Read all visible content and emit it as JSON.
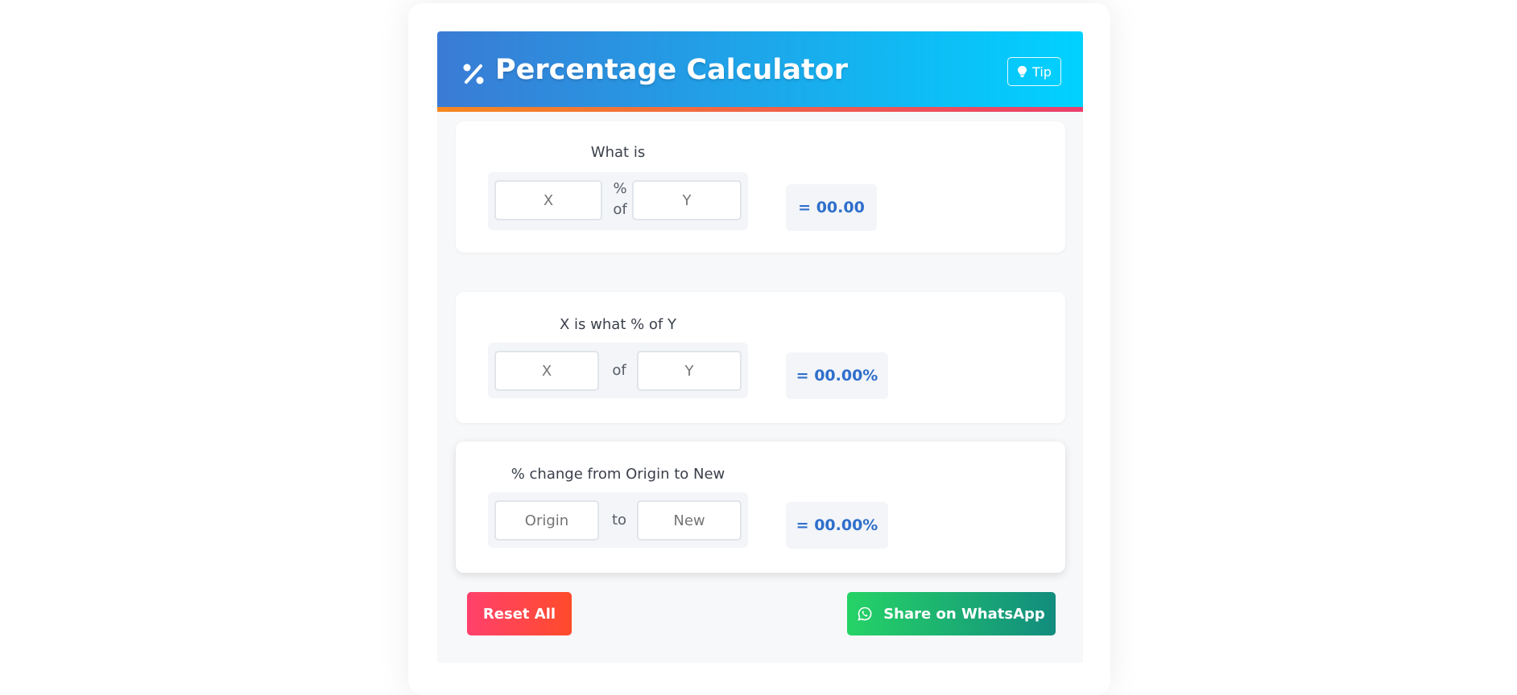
{
  "header": {
    "title": "Percentage Calculator",
    "icon": "percent-icon",
    "tip_label": "Tip",
    "tip_icon": "lightbulb-icon",
    "colors": {
      "gradient_start": "#3a7bd5",
      "gradient_end": "#00d2ff",
      "stripe_start": "#f6881f",
      "stripe_end": "#ea3e6d"
    }
  },
  "calculators": [
    {
      "label": "What is",
      "input1_placeholder": "X",
      "separator_line1": "%",
      "separator_line2": "of",
      "input2_placeholder": "Y",
      "result": "= 00.00"
    },
    {
      "label": "X is what % of Y",
      "input1_placeholder": "X",
      "separator": "of",
      "input2_placeholder": "Y",
      "result": "= 00.00%"
    },
    {
      "label": "% change from Origin to New",
      "input1_placeholder": "Origin",
      "separator": "to",
      "input2_placeholder": "New",
      "result": "= 00.00%"
    }
  ],
  "actions": {
    "reset_label": "Reset All",
    "share_label": "Share on WhatsApp",
    "share_icon": "whatsapp-icon",
    "colors": {
      "reset": "#ff4b2b",
      "share": "#25d366",
      "result_text": "#2f6fcc"
    }
  }
}
